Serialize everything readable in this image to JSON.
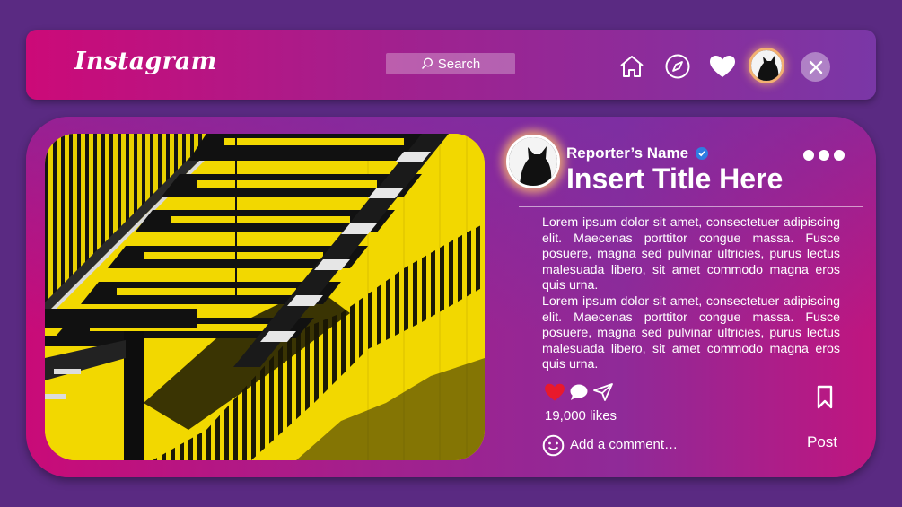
{
  "header": {
    "logo": "Instagram",
    "search_label": "Search",
    "nav": [
      "home-icon",
      "compass-icon",
      "heart-icon",
      "avatar",
      "close-icon"
    ]
  },
  "post": {
    "reporter_name": "Reporter’s Name",
    "title": "Insert Title Here",
    "paragraphs": [
      "Lorem ipsum dolor sit amet, consectetuer adipiscing elit. Maecenas porttitor congue massa. Fusce posuere, magna sed pulvinar ultricies, purus lectus malesuada libero, sit amet commodo magna eros quis urna.",
      "Lorem ipsum dolor sit amet, consectetuer adipiscing elit. Maecenas porttitor congue massa. Fusce posuere, magna sed pulvinar ultricies, purus lectus malesuada libero, sit amet commodo magna eros quis urna."
    ],
    "likes": "19,000 likes",
    "comment_placeholder": "Add a comment…",
    "post_label": "Post"
  },
  "colors": {
    "background": "#5a2a82",
    "accent_pink": "#cc0a78",
    "accent_purple": "#7a37a6",
    "like_red": "#e8192c",
    "verified_blue": "#2f7de1",
    "glow": "#f3b071"
  }
}
